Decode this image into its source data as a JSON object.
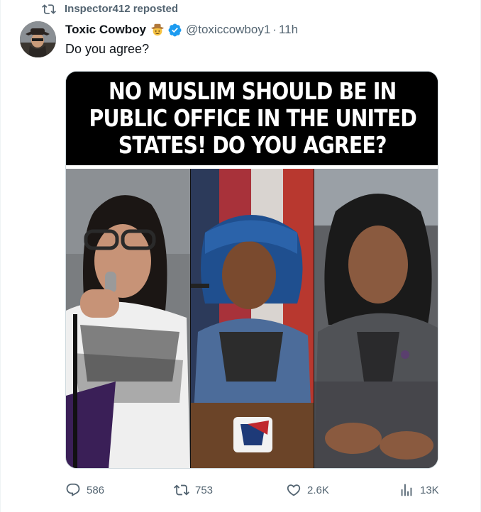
{
  "repost": {
    "text": "Inspector412 reposted"
  },
  "author": {
    "display_name": "Toxic Cowboy",
    "handle": "@toxiccowboy1",
    "separator": "·",
    "time": "11h",
    "emoji": "cowboy-hat-face"
  },
  "tweet": {
    "text": "Do you agree?"
  },
  "media": {
    "banner_lines": [
      "NO MUSLIM SHOULD BE IN",
      "PUBLIC OFFICE IN THE UNITED",
      "STATES! DO YOU AGREE?"
    ]
  },
  "actions": {
    "replies": "586",
    "reposts": "753",
    "likes": "2.6K",
    "views": "13K"
  },
  "colors": {
    "text_primary": "#0f1419",
    "text_secondary": "#536471",
    "verified_blue": "#1d9bf0",
    "border": "#cfd9de"
  }
}
